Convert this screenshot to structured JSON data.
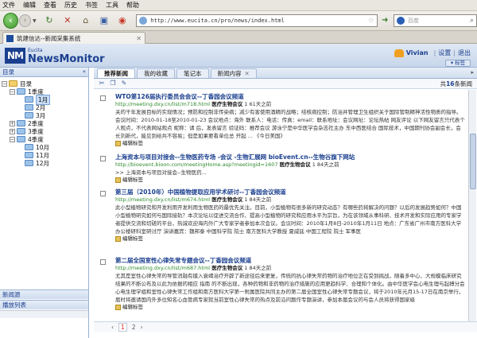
{
  "browser": {
    "menu": [
      "文件",
      "编辑",
      "查看",
      "历史",
      "书签",
      "工具",
      "帮助"
    ],
    "url": "http://www.eucita.cn/pro/news/index.html",
    "search_placeholder": "百度",
    "tab_title": "筑建信达--新闻采集系统"
  },
  "app": {
    "logo_small": "Eucita",
    "logo_big": "NewsMonitor",
    "user": "Vivian",
    "settings_link": "设置",
    "logout_link": "退出",
    "tag_button": "标签"
  },
  "left": {
    "header": "目录",
    "tree": [
      {
        "label": "目录",
        "level": 0,
        "expander": "−",
        "kind": "yellow"
      },
      {
        "label": "1季度",
        "level": 1,
        "expander": "−",
        "kind": "blue"
      },
      {
        "label": "1月",
        "level": 2,
        "expander": "",
        "kind": "blue",
        "selected": true
      },
      {
        "label": "2月",
        "level": 2,
        "expander": "",
        "kind": "blue"
      },
      {
        "label": "3月",
        "level": 2,
        "expander": "",
        "kind": "blue"
      },
      {
        "label": "2季度",
        "level": 1,
        "expander": "+",
        "kind": "blue"
      },
      {
        "label": "3季度",
        "level": 1,
        "expander": "+",
        "kind": "blue"
      },
      {
        "label": "4季度",
        "level": 1,
        "expander": "−",
        "kind": "blue"
      },
      {
        "label": "10月",
        "level": 2,
        "expander": "",
        "kind": "blue"
      },
      {
        "label": "11月",
        "level": 2,
        "expander": "",
        "kind": "blue"
      },
      {
        "label": "12月",
        "level": 2,
        "expander": "",
        "kind": "blue"
      }
    ],
    "bottom1": "新闻源",
    "bottom2": "播放列表"
  },
  "main": {
    "tabs": [
      "推荐新闻",
      "我的收藏",
      "笔记本",
      "新闻内容"
    ],
    "count_prefix": "共",
    "count_value": "16",
    "count_suffix": "条新闻",
    "items": [
      {
        "title": "WTO第126届执行委员会会议--丁香园会议频道",
        "url": "http://meeting.dxy.cn/list/m718.html",
        "source": "医疗生物会议",
        "time": "1 61天之前",
        "text": "关的干年发展目标的实现情况；预防和控制非传染病；减少有害使用酒精的战略；结核病控制；防治并管理卫生组织关于国际管制精神活性物质的指导。会议时间：2010-01-18至2010-01-23 会议地点：海外 联系人：电话：传真：email：联系地址：会议网址：论坛热帖 网友评论 以下网友留言只代表个人观点，不代表网站观点 昵称：请 后，发表留言 验证码：推荐会议 游泳宁是中华医学会杂志社主办 东中西医结合 国际技术，中国期刊协会副会长，会长刘新代，能见到给共不容易；但是如果要看单位总 开起 ... 《今日美国》",
        "tag": "编辑标签"
      },
      {
        "title": "上海资本与项目对接会--生物医药专场 -会议 -生物汇展网 bioEvent.cn--生物谷旗下网站",
        "url": "http://bioevent.bioon.com/meetingHome.asp?meetingid=1607",
        "source": "医疗生物会议",
        "time": "1 84天之前",
        "text": ">> 上海资本与项目对接会--生物医药...",
        "tag": "编辑标签"
      },
      {
        "title": "第三届（2010年）中国植物提取应用学术研讨--丁香园会议频道",
        "url": "http://meeting.dxy.cn/list/m674.html",
        "source": "医疗生物会议",
        "time": "1 84天之前",
        "text": "此小型植物研究和开发利用开发利用生物医药的最优先关注。目前，小型植物有很多新的研究动态？有哪些药将解决的问题？以后的发展趋势如何？中国小型植物研究如何与国际接轨？本次论坛以促进交流合作、提高小型植物的研究和应用水平为宗旨，为在该领域从事科研、技术开发和实际应用的专家学者提供交流和切磋的平台，热诚欢迎海内外广大专家学者参加本次会议。会议时间：2010年1月8日-2010年1月11日 地点：广东省广州市南方医科大学办公楼研科室研讨厅 演讲嘉宾：魏邦泰 中国科学院 院士 南方医科大学教授 夏威廷 中国工程院 院士 军事医",
        "tag": "编辑标签"
      },
      {
        "title": "第二届全国室性心律失常专题会议--丁香园会议频道",
        "url": "http://meeting.dxy.cn/list/m687.html",
        "source": "医疗生物会议",
        "time": "1 84天之前",
        "text": "尤其是室性心律失常的导管消融有摸入衰竭治疗开辟了新途径后来更复，传统的抗心律失常药物的治疗地位正在受到挑战，随着多中心、大规模临床研究结果的不断公布及以此为依据的相应 指南 的不断出现，各种药物和非药物的治疗措施的应用更趋科学、合理和个体化。由中华医学会心电生理与起搏分会心电生理学组和室性心律失常工作组和南方医科大学第一附属医院共同主办的第二届全国室性心律失常专题会议，将于2010年元月15-17日在南京举行，届时将邀请国内外多位知名心血管病专家就当前室性心律失常的热点及前沿问题作专题演讲，参加本届会议的与会人员将获得国家级",
        "tag": "编辑标签"
      }
    ],
    "pages": [
      "1",
      "2"
    ]
  }
}
